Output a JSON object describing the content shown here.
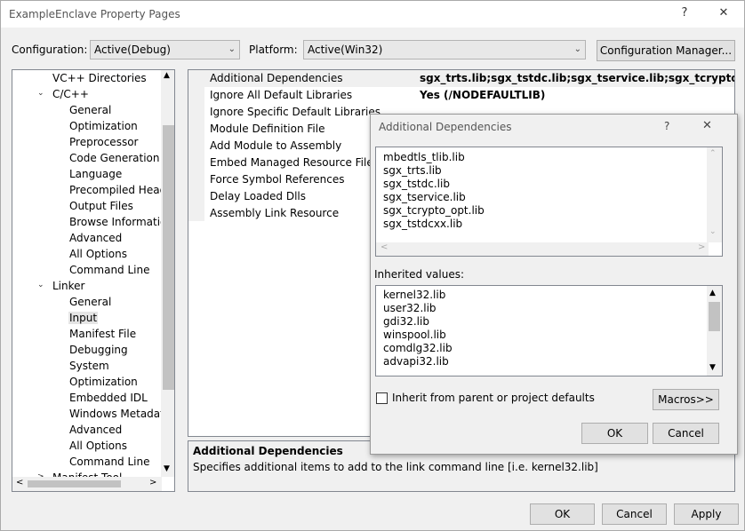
{
  "window": {
    "title": "ExampleEnclave Property Pages",
    "help": "?",
    "close": "✕"
  },
  "config": {
    "label": "Configuration:",
    "value": "Active(Debug)"
  },
  "platform": {
    "label": "Platform:",
    "value": "Active(Win32)"
  },
  "config_manager": "Configuration Manager...",
  "tree": {
    "items": [
      {
        "label": "VC++ Directories"
      },
      {
        "label": "C/C++",
        "expander": "⌄"
      },
      {
        "label": "General"
      },
      {
        "label": "Optimization"
      },
      {
        "label": "Preprocessor"
      },
      {
        "label": "Code Generation"
      },
      {
        "label": "Language"
      },
      {
        "label": "Precompiled Heade"
      },
      {
        "label": "Output Files"
      },
      {
        "label": "Browse Information"
      },
      {
        "label": "Advanced"
      },
      {
        "label": "All Options"
      },
      {
        "label": "Command Line"
      },
      {
        "label": "Linker",
        "expander": "⌄"
      },
      {
        "label": "General"
      },
      {
        "label": "Input",
        "selected": true
      },
      {
        "label": "Manifest File"
      },
      {
        "label": "Debugging"
      },
      {
        "label": "System"
      },
      {
        "label": "Optimization"
      },
      {
        "label": "Embedded IDL"
      },
      {
        "label": "Windows Metadata"
      },
      {
        "label": "Advanced"
      },
      {
        "label": "All Options"
      },
      {
        "label": "Command Line"
      },
      {
        "label": "Manifest Tool",
        "expander": ">"
      }
    ]
  },
  "properties": [
    {
      "name": "Additional Dependencies",
      "value": "sgx_trts.lib;sgx_tstdc.lib;sgx_tservice.lib;sgx_tcrypto_opt.lib;sgx_"
    },
    {
      "name": "Ignore All Default Libraries",
      "value": "Yes (/NODEFAULTLIB)"
    },
    {
      "name": "Ignore Specific Default Libraries",
      "value": ""
    },
    {
      "name": "Module Definition File",
      "value": ""
    },
    {
      "name": "Add Module to Assembly",
      "value": ""
    },
    {
      "name": "Embed Managed Resource File",
      "value": ""
    },
    {
      "name": "Force Symbol References",
      "value": ""
    },
    {
      "name": "Delay Loaded Dlls",
      "value": ""
    },
    {
      "name": "Assembly Link Resource",
      "value": ""
    }
  ],
  "description": {
    "title": "Additional Dependencies",
    "text": "Specifies additional items to add to the link command line [i.e. kernel32.lib]"
  },
  "buttons": {
    "ok": "OK",
    "cancel": "Cancel",
    "apply": "Apply"
  },
  "dialog": {
    "title": "Additional Dependencies",
    "help": "?",
    "close": "✕",
    "values": [
      "mbedtls_tlib.lib",
      "sgx_trts.lib",
      "sgx_tstdc.lib",
      "sgx_tservice.lib",
      "sgx_tcrypto_opt.lib",
      "sgx_tstdcxx.lib"
    ],
    "inherited_label": "Inherited values:",
    "inherited": [
      "kernel32.lib",
      "user32.lib",
      "gdi32.lib",
      "winspool.lib",
      "comdlg32.lib",
      "advapi32.lib"
    ],
    "inherit_checkbox": "Inherit from parent or project defaults",
    "inherit_checked": false,
    "macros": "Macros>>",
    "ok": "OK",
    "cancel": "Cancel"
  }
}
